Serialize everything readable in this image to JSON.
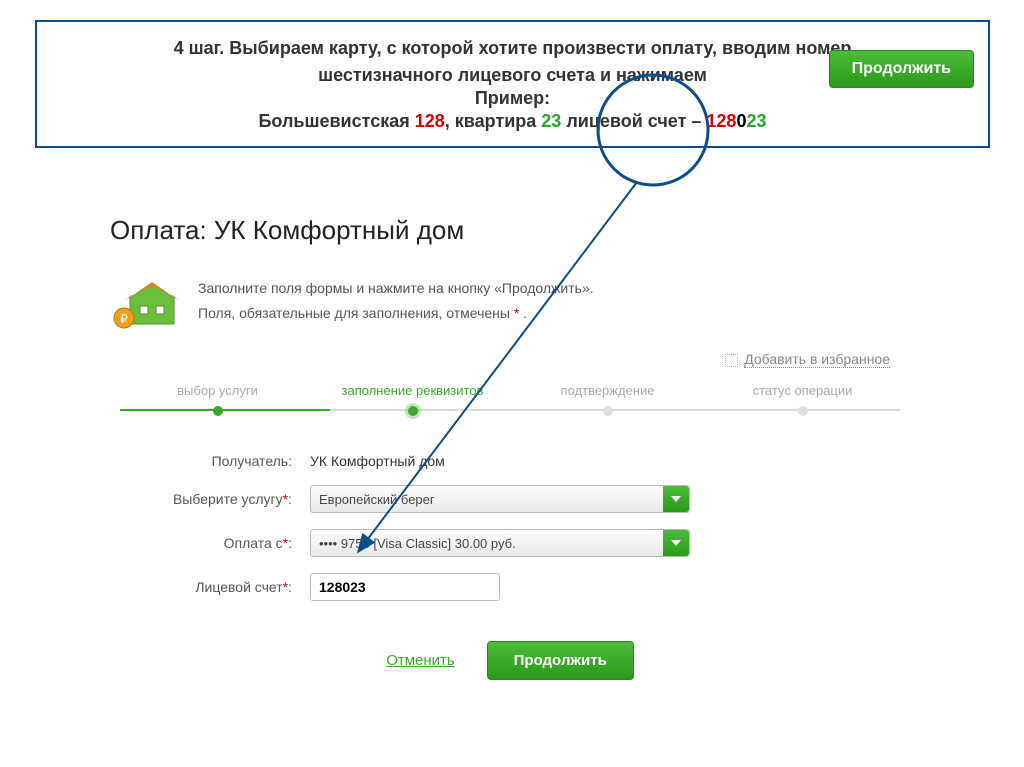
{
  "instruction": {
    "line1": "4 шаг. Выбираем карту, с которой хотите произвести оплату, вводим номер",
    "line2": "шестизначного лицевого счета и нажимаем",
    "example_label": "Пример:",
    "example_prefix": "Большевистская ",
    "example_num1": "128",
    "example_mid": ", квартира ",
    "example_num2": "23",
    "example_mid2": " лицевой счет – ",
    "example_acc_red": "128",
    "example_acc_black": "0",
    "example_acc_green": "23",
    "top_button": "Продолжить"
  },
  "payment": {
    "title": "Оплата: УК Комфортный дом",
    "info1": "Заполните поля формы и нажмите на кнопку «Продолжить».",
    "info2_prefix": "Поля, обязательные для заполнения, отмечены ",
    "info2_asterisk": "*",
    "info2_suffix": " .",
    "favorite": "Добавить в избранное"
  },
  "stepper": {
    "s1": "выбор услуги",
    "s2": "заполнение реквизитов",
    "s3": "подтверждение",
    "s4": "статус операции"
  },
  "form": {
    "recipient_label": "Получатель:",
    "recipient_value": "УК Комфортный дом",
    "service_label": "Выберите услугу",
    "service_value": "Европейский берег",
    "payfrom_label": "Оплата с",
    "payfrom_value": "•••• 9758 [Visa Classic] 30.00 руб.",
    "account_label": "Лицевой счет",
    "account_value": "128023"
  },
  "actions": {
    "cancel": "Отменить",
    "continue": "Продолжить"
  }
}
